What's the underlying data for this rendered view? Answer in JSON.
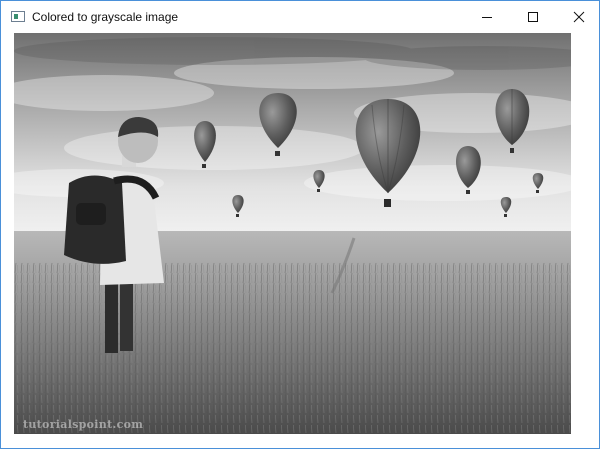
{
  "window": {
    "title": "Colored to grayscale image",
    "controls": {
      "minimize_icon": "minimize-icon",
      "maximize_icon": "maximize-icon",
      "close_icon": "close-icon"
    }
  },
  "image": {
    "description_icon": "photo",
    "watermark": "tutorialspoint.com",
    "colors": {
      "sky_light": "#e8e8e8",
      "sky_dark": "#6a6a6a",
      "field_light": "#b5b5b5",
      "field_dark": "#3a3a3a",
      "balloon": "#5a5a5a"
    }
  }
}
